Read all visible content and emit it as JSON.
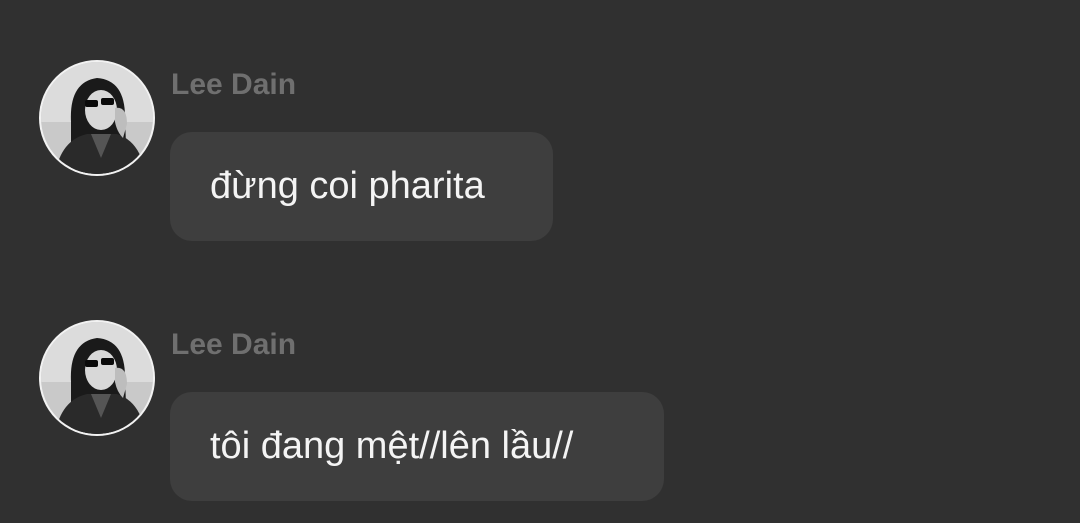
{
  "theme": {
    "background": "#303030",
    "bubble": "#3e3e3e",
    "sender_color": "#6f6f6f",
    "text_color": "#f4f4f4"
  },
  "messages": [
    {
      "sender": "Lee Dain",
      "text": "đừng coi pharita",
      "avatar_icon": "profile-photo-avatar"
    },
    {
      "sender": "Lee Dain",
      "text": "tôi đang mệt//lên lầu//",
      "avatar_icon": "profile-photo-avatar"
    }
  ]
}
